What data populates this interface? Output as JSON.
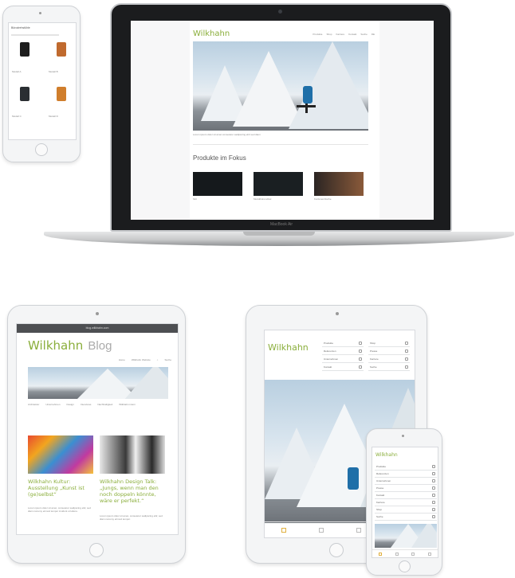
{
  "macbook": {
    "label": "MacBook Air",
    "site": {
      "logo": "Wilkhahn",
      "nav": [
        "Produkte",
        "Shop",
        "Karriere",
        "Kontakt",
        "Suche",
        "DE"
      ],
      "hero_caption_line1": "Lorem ipsum dolor sit amet consetetur sadipscing elitr sed diam",
      "section_title": "Produkte im Fokus",
      "product_captions": [
        "Sitz",
        "Modulbüromöbel",
        "Konferenztische"
      ]
    }
  },
  "iphone_left": {
    "title": "Bürodrehstühle",
    "products": [
      "Modell A",
      "Modell B",
      "Modell C",
      "Modell D"
    ]
  },
  "ipad_left": {
    "status_url": "blog.wilkhahn.com",
    "logo": "Wilkhahn",
    "logo_suffix": "Blog",
    "nav": [
      "Home",
      "Wilkhahn Website",
      "Suche"
    ],
    "categories": [
      "Architektur",
      "Unternehmen",
      "Design",
      "Interviews",
      "Nachhaltigkeit",
      "Wilkhahn intern"
    ],
    "posts": [
      {
        "title": "Wilkhahn Kultur: Ausstellung „Kunst ist (ge)selbst“",
        "excerpt": "Lorem ipsum dolor sit amet, consetetur sadipscing elitr, sed diam nonumy eirmod tempor invidunt ut labore."
      },
      {
        "title": "Wilkhahn Design Talk: „Jungs, wenn man den noch doppeln könnte, wäre er perfekt.“",
        "excerpt": "Lorem ipsum dolor sit amet, consetetur sadipscing elitr, sed diam nonumy eirmod tempor."
      }
    ]
  },
  "ipad_right": {
    "logo": "Wilkhahn",
    "menu_left": [
      "Produkte",
      "Referenzen",
      "Unternehmen",
      "Kontakt"
    ],
    "menu_right": [
      "Shop",
      "Presse",
      "Karriere",
      "Suche"
    ]
  },
  "iphone_right": {
    "logo": "Wilkhahn",
    "menu": [
      "Produkte",
      "Referenzen",
      "Unternehmen",
      "Presse",
      "Kontakt",
      "Karriere",
      "Shop",
      "Suche"
    ]
  },
  "colors": {
    "brand_green": "#8aae3b",
    "device_frame": "#f4f5f6",
    "laptop_bezel": "#1b1c1e"
  }
}
